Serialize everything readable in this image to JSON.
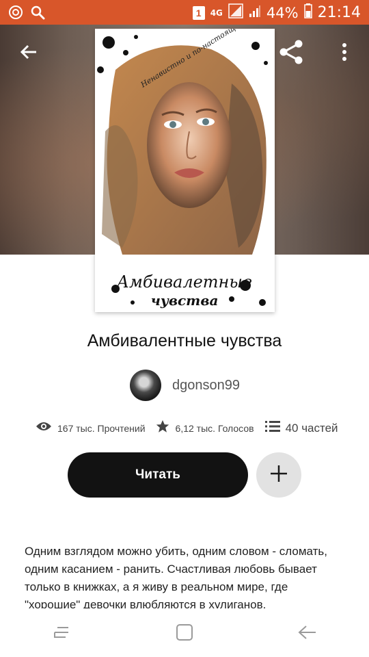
{
  "status_bar": {
    "sim_badge": "1",
    "network": "4G",
    "battery": "44%",
    "time": "21:14",
    "color": "#d8562a"
  },
  "toolbar": {
    "back_icon": "arrow-left-icon",
    "share_icon": "share-icon",
    "menu_icon": "more-vertical-icon"
  },
  "cover": {
    "tagline": "Ненавистно и по-настоящему",
    "title_line1": "Амбивалетные",
    "title_line2": "чувства"
  },
  "story": {
    "title": "Амбивалентные чувства",
    "author": "dgonson99"
  },
  "stats": {
    "reads": "167 тыс. Прочтений",
    "votes": "6,12 тыс. Голосов",
    "parts": "40 частей"
  },
  "actions": {
    "read_label": "Читать",
    "add_icon": "plus-icon"
  },
  "description": "Одним взглядом можно убить, одним словом - сломать, одним касанием - ранить. Счастливая любовь бывает только в книжках, а я живу в реальном мире, где \"хорошие\" девочки влюбляются в хулиганов.",
  "nav_bar": {
    "recent_icon": "recent-apps-icon",
    "home_icon": "home-icon",
    "back_icon": "back-icon"
  }
}
